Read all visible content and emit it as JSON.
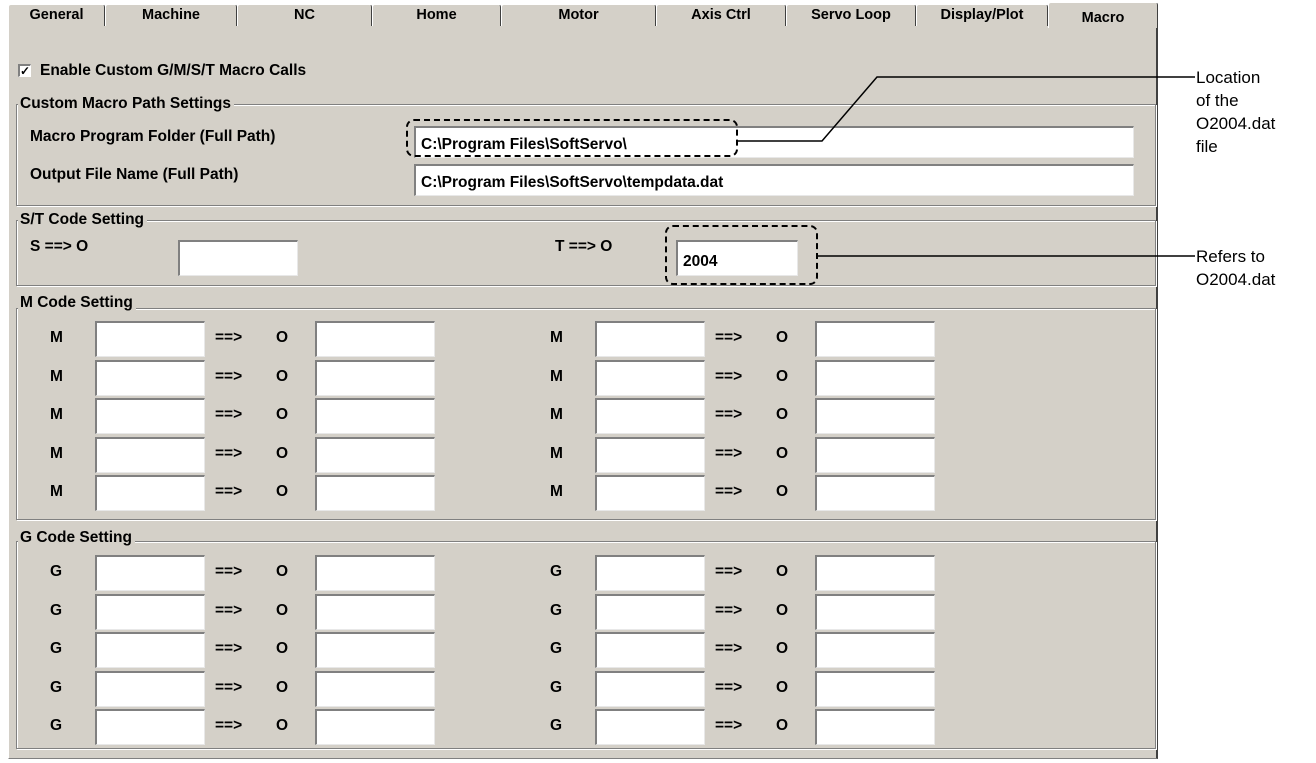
{
  "tabs": [
    {
      "label": "General"
    },
    {
      "label": "Machine"
    },
    {
      "label": "NC"
    },
    {
      "label": "Home"
    },
    {
      "label": "Motor"
    },
    {
      "label": "Axis Ctrl"
    },
    {
      "label": "Servo Loop"
    },
    {
      "label": "Display/Plot"
    },
    {
      "label": "Macro"
    }
  ],
  "enable_macro": {
    "label": "Enable Custom G/M/S/T Macro Calls",
    "checked_mark": "✓"
  },
  "path_group": {
    "title": "Custom Macro Path Settings",
    "folder_label": "Macro Program Folder (Full Path)",
    "folder_value": "C:\\Program Files\\SoftServo\\",
    "output_label": "Output File Name (Full Path)",
    "output_value": "C:\\Program Files\\SoftServo\\tempdata.dat"
  },
  "st_group": {
    "title": "S/T Code Setting",
    "s_label": "S ==> O",
    "s_value": "",
    "t_label": "T ==> O",
    "t_value": "2004"
  },
  "m_group": {
    "title": "M Code Setting",
    "prefix": "M",
    "arrow": "==>",
    "target": "O"
  },
  "g_group": {
    "title": "G Code Setting",
    "prefix": "G",
    "arrow": "==>",
    "target": "O"
  },
  "annotations": {
    "location_lines": [
      "Location",
      "of the",
      "O2004.dat",
      "file"
    ],
    "refers_lines": [
      "Refers to",
      "O2004.dat"
    ]
  }
}
